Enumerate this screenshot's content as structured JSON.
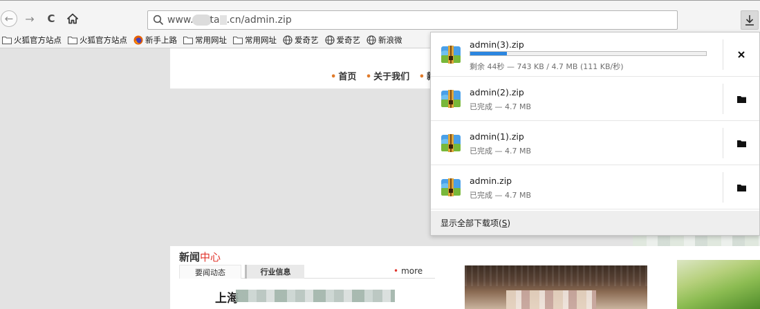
{
  "url": {
    "prefix": "www.",
    "part2": "ta",
    "suffix": ".cn/admin.zip"
  },
  "bookmarks": [
    {
      "label": "火狐官方站点",
      "icon": "folder-icon"
    },
    {
      "label": "火狐官方站点",
      "icon": "folder-icon"
    },
    {
      "label": "新手上路",
      "icon": "firefox-icon"
    },
    {
      "label": "常用网址",
      "icon": "folder-icon"
    },
    {
      "label": "常用网址",
      "icon": "folder-icon"
    },
    {
      "label": "爱奇艺",
      "icon": "globe-icon"
    },
    {
      "label": "爱奇艺",
      "icon": "globe-icon"
    },
    {
      "label": "新浪微",
      "icon": "globe-icon"
    }
  ],
  "page": {
    "nav": [
      "首页",
      "关于我们",
      "新"
    ],
    "news_title_black": "新闻",
    "news_title_red": "中心",
    "tab_1": "要闻动态",
    "tab_2": "行业信息",
    "more_dot": "•",
    "more": "more",
    "headline": "上海"
  },
  "downloads": {
    "items": [
      {
        "name": "admin(3).zip",
        "status": "剩余 44秒 — 743 KB / 4.7 MB (111 KB/秒)",
        "progress": 0.156,
        "action_icon": "cancel-icon"
      },
      {
        "name": "admin(2).zip",
        "status": "已完成 — 4.7 MB",
        "action_icon": "folder-open-icon"
      },
      {
        "name": "admin(1).zip",
        "status": "已完成 — 4.7 MB",
        "action_icon": "folder-open-icon"
      },
      {
        "name": "admin.zip",
        "status": "已完成 — 4.7 MB",
        "action_icon": "folder-open-icon"
      }
    ],
    "footer_label": "显示全部下载项(",
    "footer_key": "S",
    "footer_close": ")"
  },
  "colors": {
    "accent": "#2b86e0",
    "nav_dot": "#e07a2a",
    "news_red": "#e0332a"
  }
}
